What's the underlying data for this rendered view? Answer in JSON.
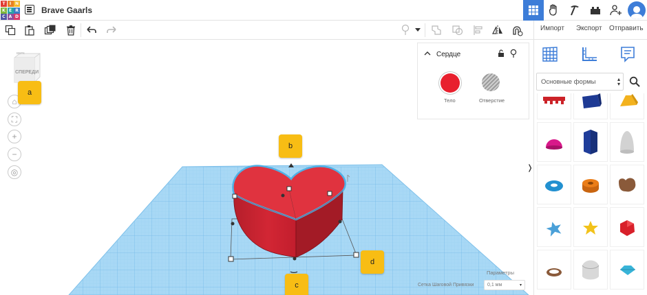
{
  "app": {
    "project_title": "Brave Gaarls",
    "logo_letters": [
      "T",
      "I",
      "N",
      "K",
      "E",
      "R",
      "C",
      "A",
      "D"
    ],
    "logo_colors": [
      "#e23c32",
      "#e88024",
      "#f4b92c",
      "#7fb63b",
      "#2aa6a5",
      "#3a7cc4",
      "#5155a4",
      "#8e4f9d",
      "#d93a6b"
    ]
  },
  "topbar": {
    "icons": [
      "grid-view-icon",
      "tinker-hand-icon",
      "pickaxe-icon",
      "bricks-icon",
      "add-user-icon",
      "user-avatar"
    ]
  },
  "toolbar": {
    "import_label": "Импорт",
    "export_label": "Экспорт",
    "send_label": "Отправить"
  },
  "viewcube": {
    "top_text": "ВЕРХ",
    "front_text": "СПЕРЕДИ"
  },
  "callouts": {
    "a": "a",
    "b": "b",
    "c": "c",
    "d": "d"
  },
  "inspector": {
    "title": "Сердце",
    "solid_label": "Тело",
    "hole_label": "Отверстие",
    "solid_color": "#e8202e"
  },
  "settings": {
    "params_label": "Параметры",
    "snap_label": "Сетка Шаговой Привязки",
    "snap_value": "0,1 мм"
  },
  "shapes_panel": {
    "category_value": "Основные формы",
    "shapes": [
      {
        "name": "text-shape",
        "color": "#cc2228"
      },
      {
        "name": "box-shape",
        "color": "#1e3a94"
      },
      {
        "name": "roof-shape",
        "color": "#f3b21e"
      },
      {
        "name": "half-sphere-shape",
        "color": "#d8188a"
      },
      {
        "name": "polygon-shape",
        "color": "#1f3d9a"
      },
      {
        "name": "paraboloid-shape",
        "color": "#cfcfcf"
      },
      {
        "name": "torus-shape",
        "color": "#2290d0"
      },
      {
        "name": "tube-shape",
        "color": "#ea7d18"
      },
      {
        "name": "wedge-shape",
        "color": "#8a5a3a"
      },
      {
        "name": "star-shape",
        "color": "#4aa0d8"
      },
      {
        "name": "star-gold-shape",
        "color": "#f2c21a"
      },
      {
        "name": "icosahedron-shape",
        "color": "#d8202a"
      },
      {
        "name": "ring-shape",
        "color": "#8a5a3a"
      },
      {
        "name": "round-roof-shape",
        "color": "#d8d8d8"
      },
      {
        "name": "diamond-shape",
        "color": "#38b4d8"
      }
    ]
  }
}
